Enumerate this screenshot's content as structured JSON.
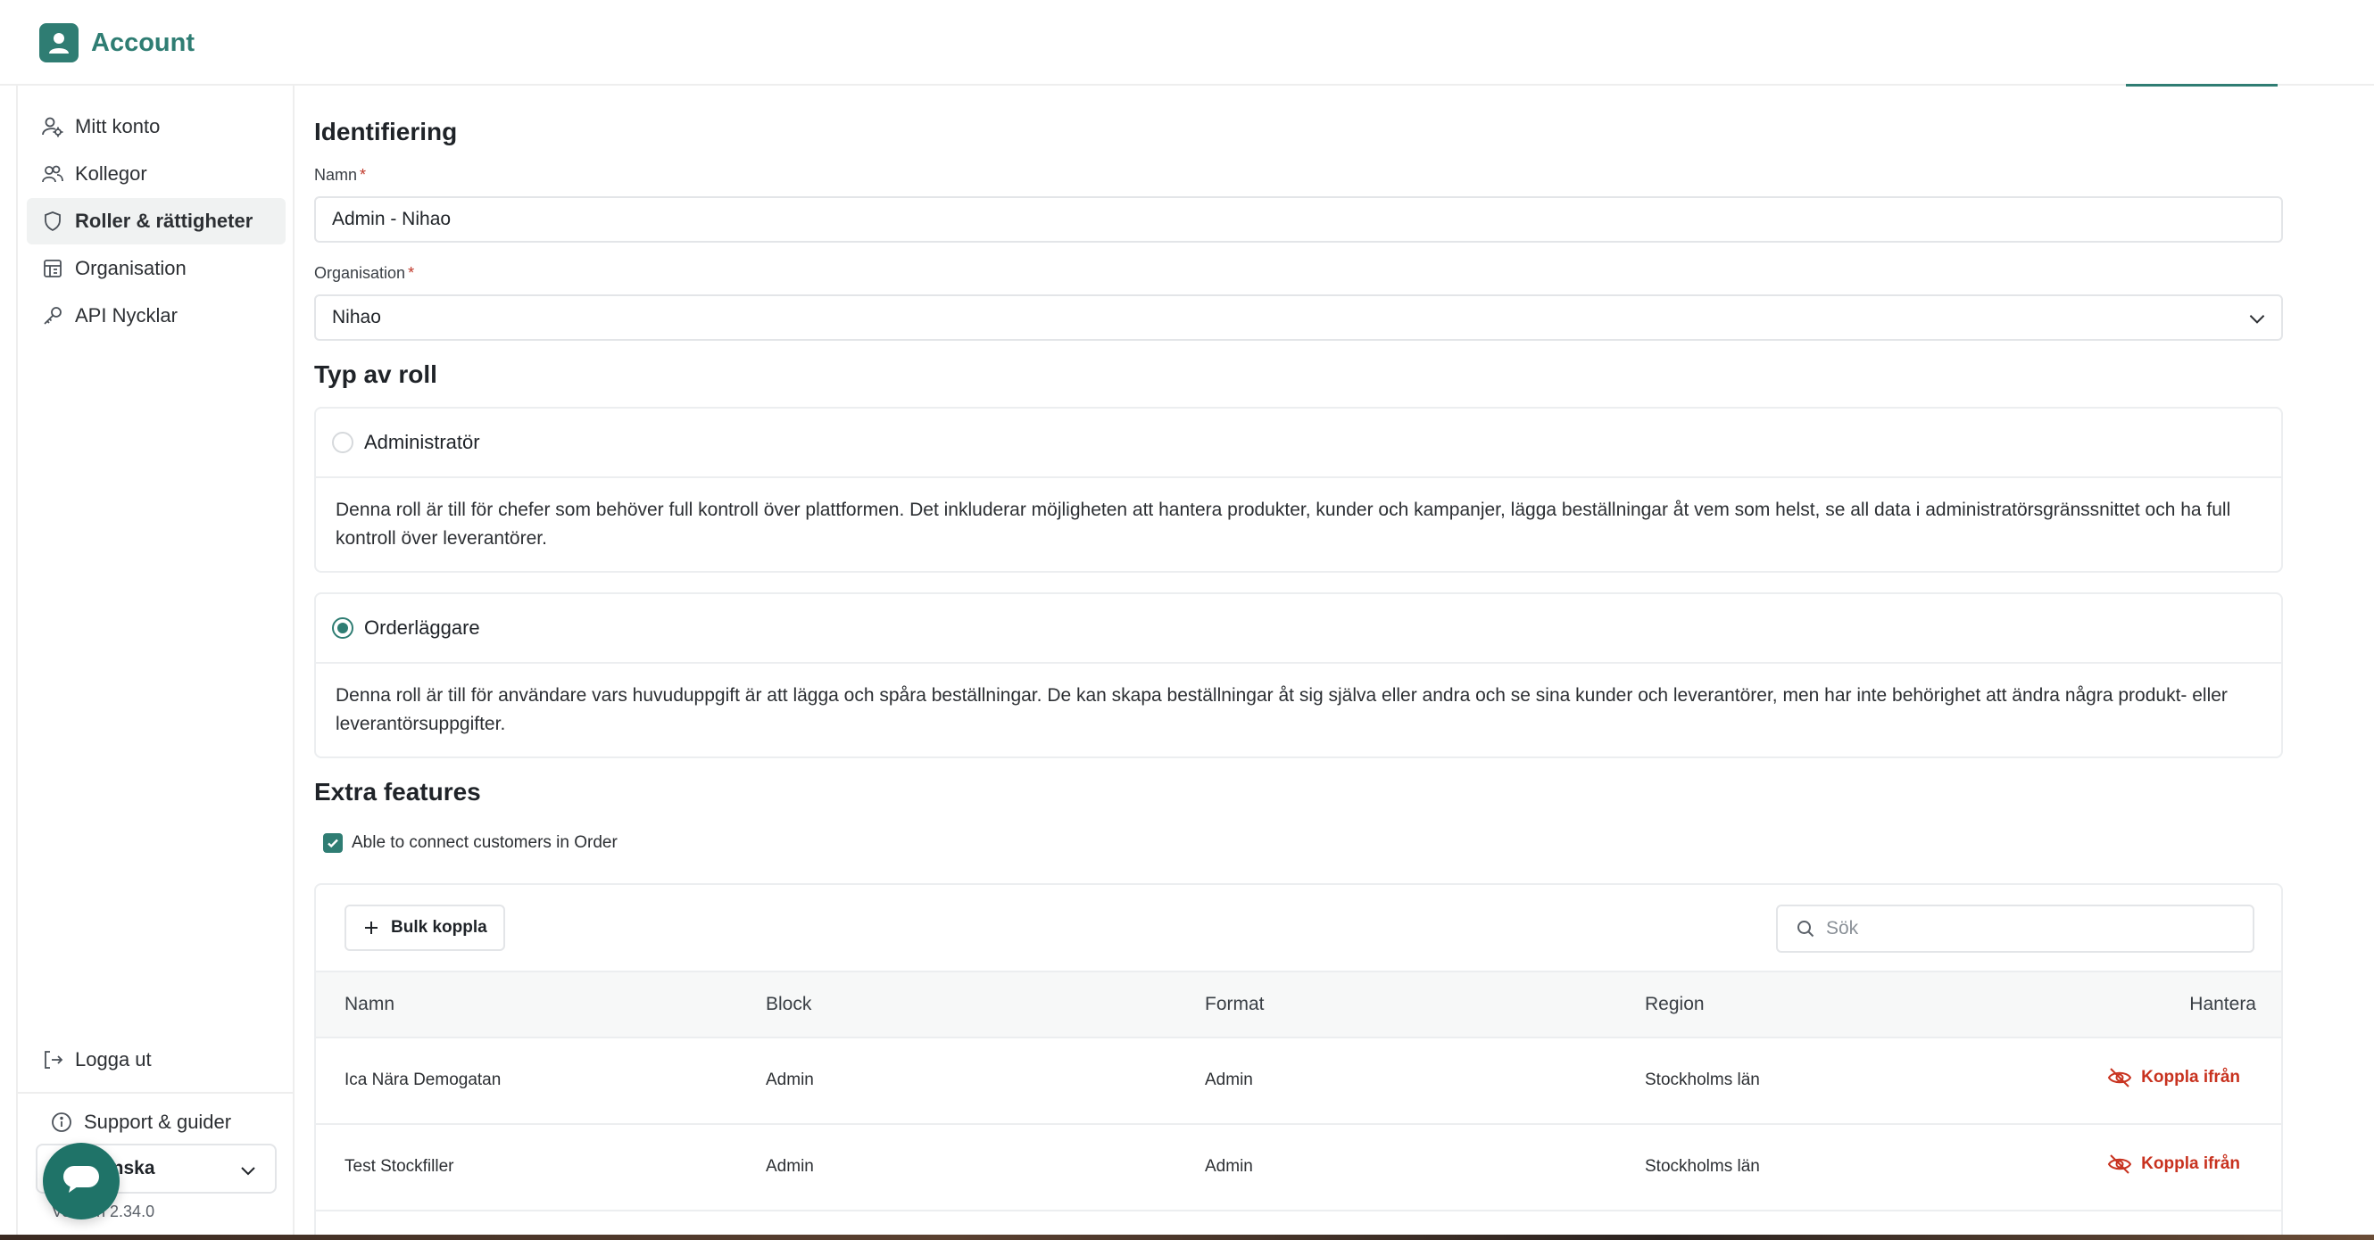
{
  "app": {
    "title": "Account"
  },
  "sidebar": {
    "items": [
      {
        "label": "Mitt konto",
        "icon": "user-gear-icon"
      },
      {
        "label": "Kollegor",
        "icon": "users-icon"
      },
      {
        "label": "Roller & rättigheter",
        "icon": "shield-icon",
        "active": true
      },
      {
        "label": "Organisation",
        "icon": "building-icon"
      },
      {
        "label": "API Nycklar",
        "icon": "key-icon"
      }
    ],
    "logout": "Logga ut",
    "support": "Support & guider",
    "language": "Svenska",
    "language_visible": "enska",
    "version": "Version 2.34.0"
  },
  "identification": {
    "title": "Identifiering",
    "name_label": "Namn",
    "name_value": "Admin - Nihao",
    "org_label": "Organisation",
    "org_value": "Nihao",
    "required_mark": "*"
  },
  "role_type": {
    "title": "Typ av roll",
    "roles": [
      {
        "name": "Administratör",
        "selected": false,
        "description": "Denna roll är till för chefer som behöver full kontroll över plattformen. Det inkluderar möjligheten att hantera produkter, kunder och kampanjer, lägga beställningar åt vem som helst, se all data i administratörsgränssnittet och ha full kontroll över leverantörer."
      },
      {
        "name": "Orderläggare",
        "selected": true,
        "description": "Denna roll är till för användare vars huvuduppgift är att lägga och spåra beställningar. De kan skapa beställningar åt sig själva eller andra och se sina kunder och leverantörer, men har inte behörighet att ändra några produkt- eller leverantörsuppgifter."
      }
    ]
  },
  "extra_features": {
    "title": "Extra features",
    "checkbox_label": "Able to connect customers in Order",
    "checked": true
  },
  "table": {
    "bulk_button": "Bulk koppla",
    "search_placeholder": "Sök",
    "columns": [
      "Namn",
      "Block",
      "Format",
      "Region",
      "Hantera"
    ],
    "rows": [
      {
        "name": "Ica Nära Demogatan",
        "block": "Admin",
        "format": "Admin",
        "region": "Stockholms län",
        "action": "Koppla ifrån"
      },
      {
        "name": "Test Stockfiller",
        "block": "Admin",
        "format": "Admin",
        "region": "Stockholms län",
        "action": "Koppla ifrån"
      }
    ]
  },
  "colors": {
    "accent": "#2f7d73",
    "danger": "#c8321f",
    "chat": "#1f7368"
  }
}
